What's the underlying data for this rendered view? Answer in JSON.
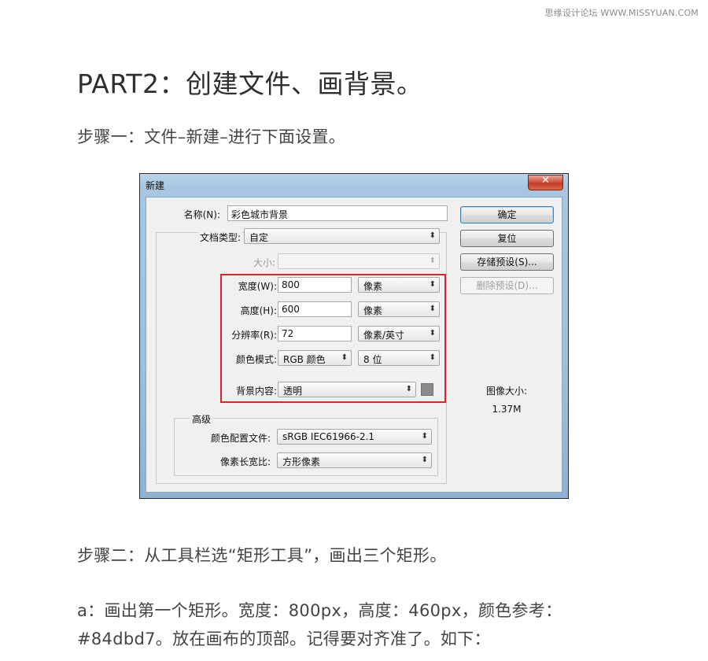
{
  "watermark": "思缘设计论坛 WWW.MISSYUAN.COM",
  "heading": "PART2：创建文件、画背景。",
  "step1": "步骤一：文件–新建–进行下面设置。",
  "step2": "步骤二：从工具栏选“矩形工具”，画出三个矩形。",
  "step_a_line1": "a：画出第一个矩形。宽度：800px，高度：460px，颜色参考：",
  "step_a_line2": "#84dbd7。放在画布的顶部。记得要对齐准了。如下：",
  "dialog": {
    "title": "新建",
    "close_icon": "close-icon",
    "name_label": "名称(N):",
    "name_value": "彩色城市背景",
    "preset_label": "文档类型:",
    "preset_value": "自定",
    "size_label": "大小:",
    "size_value": "",
    "width_label": "宽度(W):",
    "width_value": "800",
    "width_unit": "像素",
    "height_label": "高度(H):",
    "height_value": "600",
    "height_unit": "像素",
    "resolution_label": "分辨率(R):",
    "resolution_value": "72",
    "resolution_unit": "像素/英寸",
    "color_mode_label": "颜色模式:",
    "color_mode_value": "RGB 颜色",
    "bit_depth_value": "8 位",
    "background_label": "背景内容:",
    "background_value": "透明",
    "advanced_title": "高级",
    "color_profile_label": "颜色配置文件:",
    "color_profile_value": "sRGB IEC61966-2.1",
    "pixel_aspect_label": "像素长宽比:",
    "pixel_aspect_value": "方形像素",
    "ok_button": "确定",
    "reset_button": "复位",
    "save_preset_button": "存储预设(S)...",
    "delete_preset_button": "删除预设(D)...",
    "image_size_label": "图像大小:",
    "image_size_value": "1.37M",
    "dropdown_arrow": "⬍"
  },
  "colors": {
    "highlight_box": "#e0222b",
    "background_swatch": "#8b8b8b"
  }
}
